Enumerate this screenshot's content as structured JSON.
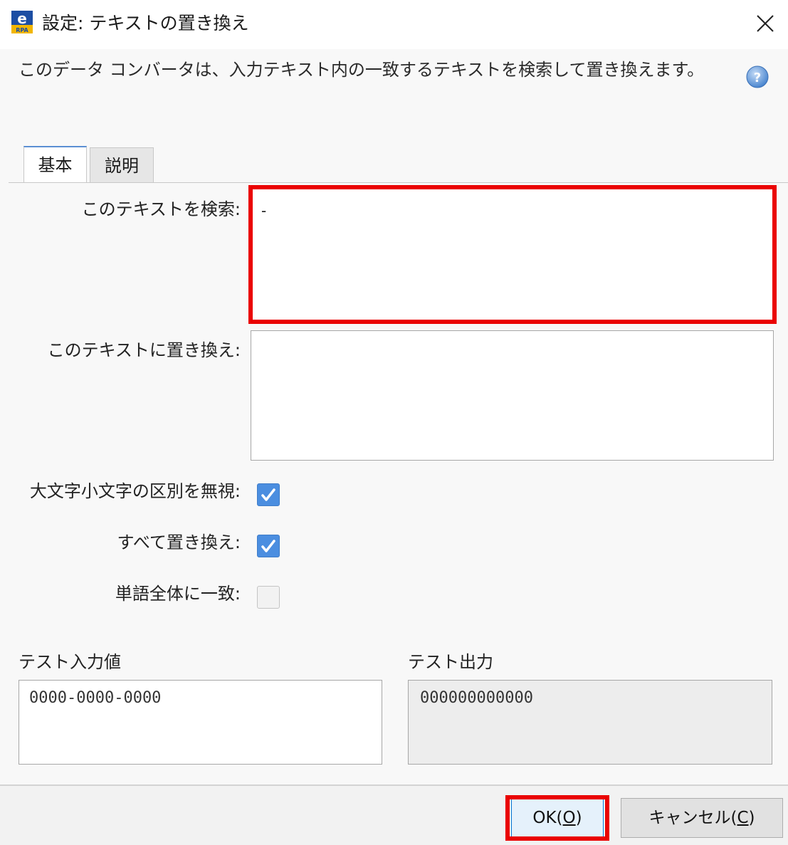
{
  "window": {
    "title": "設定: テキストの置き換え",
    "close_glyph": "✕",
    "app_icon_letter": "e",
    "app_icon_sub": "RPA"
  },
  "description": "このデータ コンバータは、入力テキスト内の一致するテキストを検索して置き換えます。",
  "tabs": [
    {
      "label": "基本",
      "selected": true
    },
    {
      "label": "説明",
      "selected": false
    }
  ],
  "fields": {
    "search": {
      "label": "このテキストを検索:",
      "value": "-"
    },
    "replace": {
      "label": "このテキストに置き換え:",
      "value": ""
    }
  },
  "options": [
    {
      "label": "大文字小文字の区別を無視:",
      "checked": true
    },
    {
      "label": "すべて置き換え:",
      "checked": true
    },
    {
      "label": "単語全体に一致:",
      "checked": false
    }
  ],
  "test": {
    "input_label": "テスト入力値",
    "input_value": "0000-0000-0000",
    "output_label": "テスト出力",
    "output_value": "000000000000"
  },
  "buttons": {
    "ok_prefix": "OK(",
    "ok_key": "O",
    "ok_suffix": ")",
    "cancel_prefix": "キャンセル(",
    "cancel_key": "C",
    "cancel_suffix": ")"
  },
  "colors": {
    "highlight": "#ea0000",
    "checkbox_checked": "#4b8ee0",
    "tab_accent": "#5b8fd3"
  }
}
